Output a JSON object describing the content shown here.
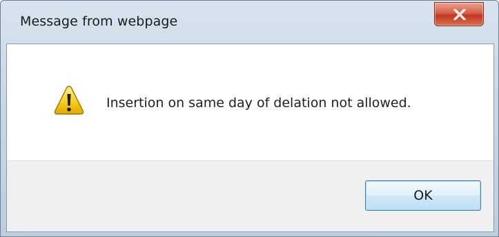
{
  "dialog": {
    "title": "Message from webpage",
    "message": "Insertion on same day of delation not allowed.",
    "ok_label": "OK",
    "icon": "warning-icon",
    "close_icon": "close-icon"
  },
  "colors": {
    "close_button": "#c94a2e",
    "warning_yellow": "#f4c400",
    "ok_border": "#3c7fb1"
  }
}
